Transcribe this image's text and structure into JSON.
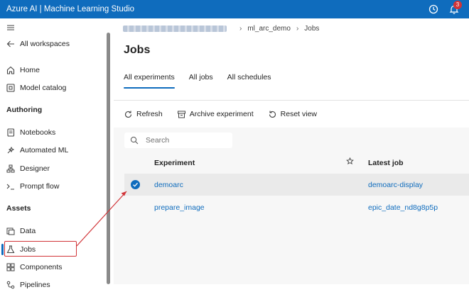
{
  "app": {
    "title": "Azure AI | Machine Learning Studio",
    "notification_count": "3"
  },
  "sidebar": {
    "all_workspaces": "All workspaces",
    "home": "Home",
    "model_catalog": "Model catalog",
    "authoring_heading": "Authoring",
    "notebooks": "Notebooks",
    "automated_ml": "Automated ML",
    "designer": "Designer",
    "prompt_flow": "Prompt flow",
    "assets_heading": "Assets",
    "data": "Data",
    "jobs": "Jobs",
    "components": "Components",
    "pipelines": "Pipelines"
  },
  "breadcrumb": {
    "experiment": "ml_arc_demo",
    "current": "Jobs"
  },
  "page": {
    "title": "Jobs"
  },
  "tabs": [
    {
      "label": "All experiments",
      "active": true
    },
    {
      "label": "All jobs",
      "active": false
    },
    {
      "label": "All schedules",
      "active": false
    }
  ],
  "toolbar": {
    "refresh": "Refresh",
    "archive": "Archive experiment",
    "reset": "Reset view"
  },
  "search": {
    "placeholder": "Search"
  },
  "table": {
    "headers": {
      "experiment": "Experiment",
      "latest_job": "Latest job"
    },
    "rows": [
      {
        "experiment": "demoarc",
        "latest_job": "demoarc-display",
        "selected": true
      },
      {
        "experiment": "prepare_image",
        "latest_job": "epic_date_nd8g8p5p",
        "selected": false
      }
    ]
  },
  "colors": {
    "accent": "#0f6cbd",
    "annotation": "#d13438"
  }
}
